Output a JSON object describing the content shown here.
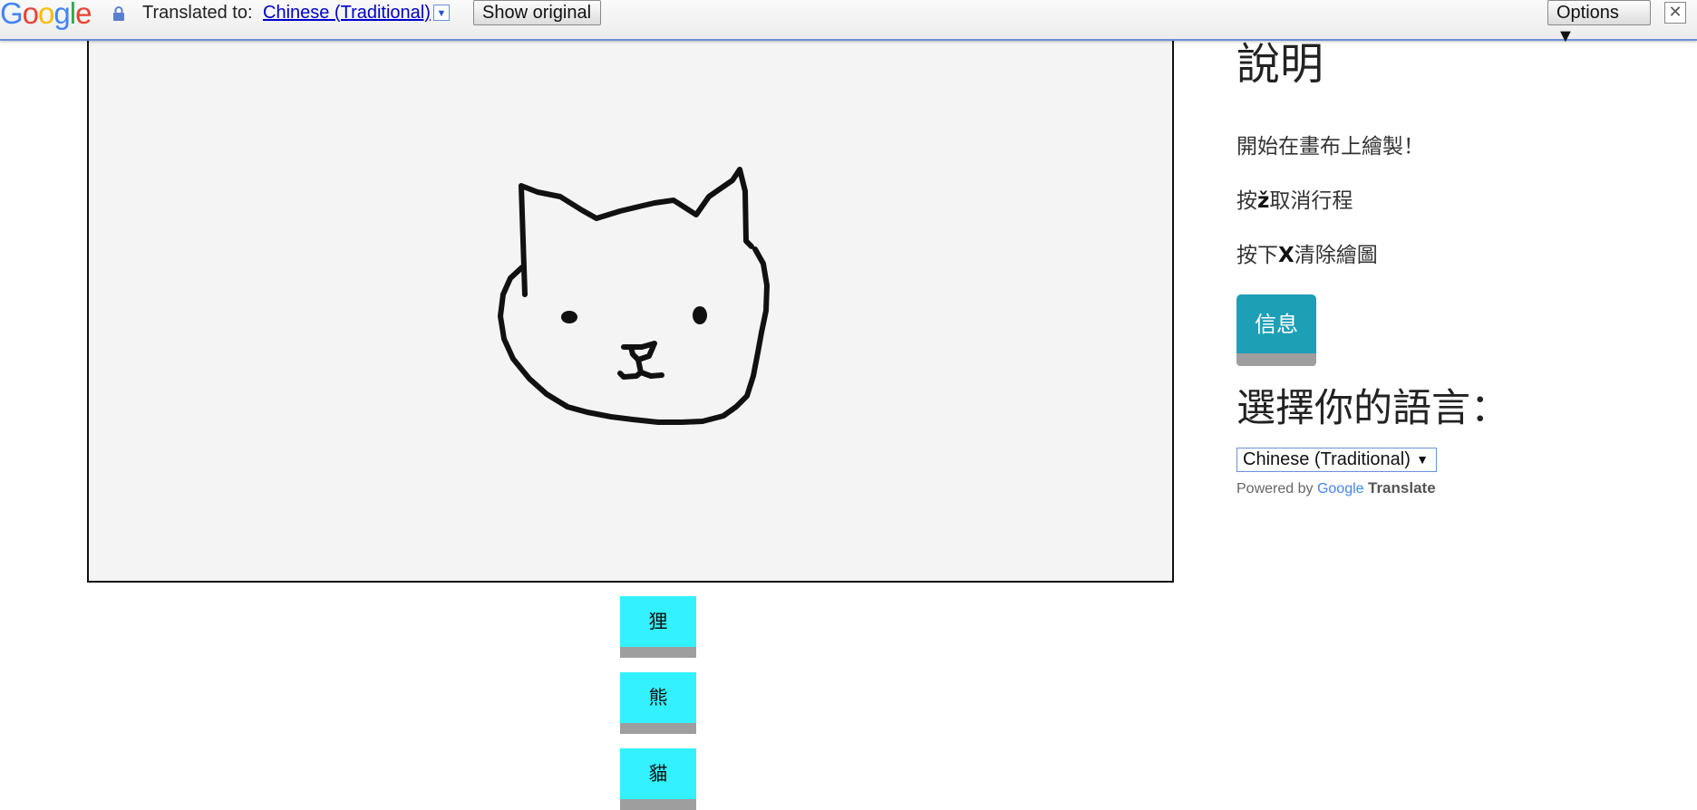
{
  "translate_bar": {
    "logo_letters": [
      "G",
      "o",
      "o",
      "g",
      "l",
      "e"
    ],
    "translated_to_label": "Translated to:",
    "language_link": "Chinese (Traditional)",
    "dropdown_arrow": "▼",
    "show_original_label": "Show original",
    "options_label": "Options ▼",
    "close_label": "✕",
    "icons": {
      "lock": "lock-icon",
      "close": "close-icon"
    }
  },
  "canvas": {
    "background_color": "#f4f4f4",
    "stroke_color": "#111111",
    "content": "cat-face-sketch"
  },
  "guesses": [
    "狸",
    "熊",
    "貓"
  ],
  "panel": {
    "title": "說明",
    "start_text": "開始在畫布上繪製！",
    "undo_prefix": "按",
    "undo_key": "ž",
    "undo_suffix": "取消行程",
    "clear_prefix": "按下",
    "clear_key": "X",
    "clear_suffix": "清除繪圖",
    "info_button": "信息",
    "language_heading": "選擇你的語言：",
    "language_selected": "Chinese (Traditional)",
    "language_arrow": "▼",
    "powered_by": "Powered by",
    "powered_google": "Google",
    "powered_translate": "Translate"
  },
  "colors": {
    "guess_button": "#33f1ff",
    "info_button": "#1d9fb6",
    "button_shadow": "#9e9e9e",
    "link_blue": "#0000cc"
  }
}
